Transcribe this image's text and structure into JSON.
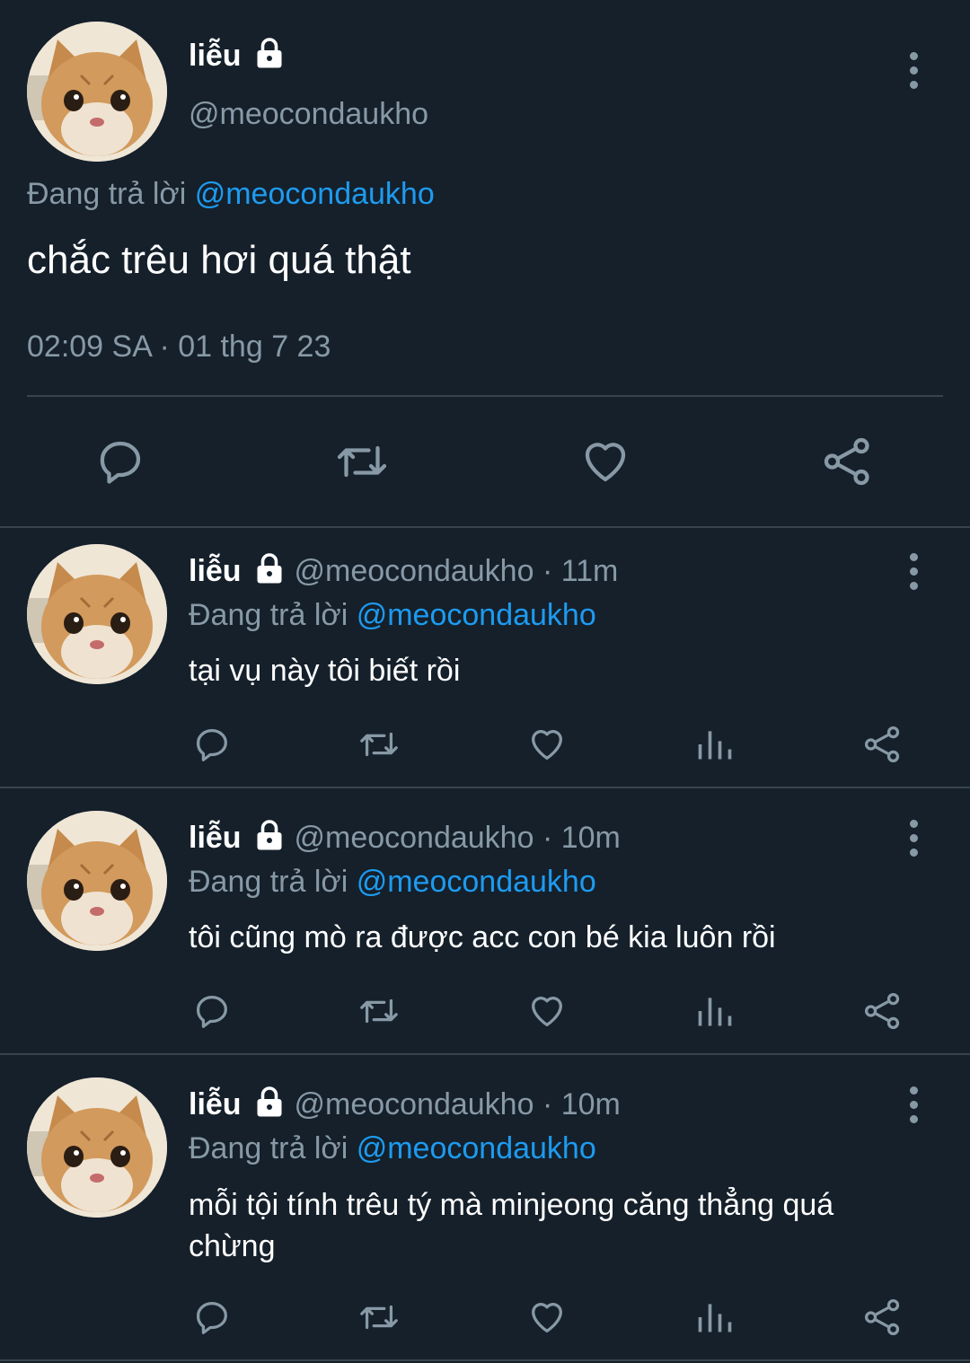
{
  "main_tweet": {
    "display_name": "liễu",
    "handle": "@meocondaukho",
    "replying_prefix": "Đang trả lời",
    "replying_handle": "@meocondaukho",
    "text": "chắc trêu hơi quá thật",
    "timestamp": "02:09 SA · 01 thg 7 23"
  },
  "replies": [
    {
      "display_name": "liễu",
      "handle_time": "@meocondaukho · 11m",
      "replying_prefix": "Đang trả lời",
      "replying_handle": "@meocondaukho",
      "text": "tại vụ này tôi biết rồi"
    },
    {
      "display_name": "liễu",
      "handle_time": "@meocondaukho · 10m",
      "replying_prefix": "Đang trả lời",
      "replying_handle": "@meocondaukho",
      "text": "tôi cũng mò ra được acc con bé kia luôn rồi"
    },
    {
      "display_name": "liễu",
      "handle_time": "@meocondaukho · 10m",
      "replying_prefix": "Đang trả lời",
      "replying_handle": "@meocondaukho",
      "text_line1": "mỗi tội tính trêu tý mà minjeong căng thẳng quá",
      "text_line2": "chừng"
    }
  ],
  "icons": {
    "reply": "speech-bubble-icon",
    "retweet": "retweet-icon",
    "like": "heart-icon",
    "analytics": "bar-chart-icon",
    "share": "share-icon",
    "lock": "lock-icon",
    "more": "more-vertical-icon"
  },
  "colors": {
    "background": "#15202b",
    "muted": "#8899a6",
    "link": "#1d9bf0",
    "divider": "#38444d"
  }
}
